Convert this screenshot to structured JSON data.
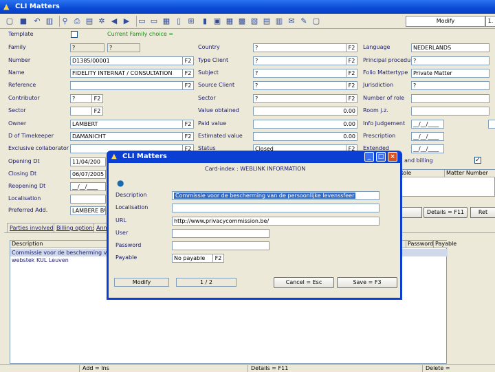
{
  "app": {
    "title": "CLI Matters"
  },
  "toolbar": {
    "mode": "Modify",
    "page": "1."
  },
  "form": {
    "template": {
      "label": "Template",
      "checked": false,
      "note": "Current Family choice ="
    },
    "family": {
      "label": "Family",
      "value1": "?",
      "value2": "?"
    },
    "number": {
      "label": "Number",
      "value": "D1385/00001",
      "btn": "F2"
    },
    "name": {
      "label": "Name",
      "value": "FIDELITY INTERNAT / CONSULTATION",
      "btn": "F2"
    },
    "reference": {
      "label": "Reference",
      "value": "",
      "btn": "F2"
    },
    "contributor": {
      "label": "Contributor",
      "value": "?",
      "btn": "F2"
    },
    "sector_left": {
      "label": "Sector",
      "value": "",
      "btn": "F2"
    },
    "owner": {
      "label": "Owner",
      "value": "LAMBERT",
      "btn": "F2"
    },
    "timekeeper": {
      "label": "D of Timekeeper",
      "value": "DAMANICHT",
      "btn": "F2"
    },
    "exclusive": {
      "label": "Exclusive collaborator",
      "value": "",
      "btn": "F2"
    },
    "opening": {
      "label": "Opening Dt",
      "value": "11/04/200"
    },
    "closing": {
      "label": "Closing Dt",
      "value": "06/07/2005"
    },
    "reopening": {
      "label": "Reopening Dt",
      "value": "__/__/____"
    },
    "localisation": {
      "label": "Localisation",
      "value": ""
    },
    "preferred": {
      "label": "Preferred Add.",
      "value": "LAMBERE BV"
    },
    "country": {
      "label": "Country",
      "value": "?",
      "btn": "F2"
    },
    "type_client": {
      "label": "Type Client",
      "value": "?",
      "btn": "F2"
    },
    "subject": {
      "label": "Subject",
      "value": "?",
      "btn": "F2"
    },
    "source_client": {
      "label": "Source Client",
      "value": "?",
      "btn": "F2"
    },
    "sector_mid": {
      "label": "Sector",
      "value": "?",
      "btn": "F2"
    },
    "value_obtained": {
      "label": "Value obtained",
      "value": "0.00"
    },
    "paid_value": {
      "label": "Paid value",
      "value": "0.00"
    },
    "estimated_value": {
      "label": "Estimated value",
      "value": "0.00"
    },
    "status": {
      "label": "Status",
      "value": "Closed",
      "btn": "F2"
    },
    "language": {
      "label": "Language",
      "value": "NEDERLANDS"
    },
    "principal": {
      "label": "Principal procedure",
      "value": "?"
    },
    "folio": {
      "label": "Folio Mattertype",
      "value": "Private Matter"
    },
    "jurisdiction": {
      "label": "Jurisdiction",
      "value": "?"
    },
    "number_of_role": {
      "label": "Number of role",
      "value": ""
    },
    "room": {
      "label": "Room j.z.",
      "value": ""
    },
    "info_judgement": {
      "label": "Info Judgement",
      "value": "__/__/____"
    },
    "prescription": {
      "label": "Prescription",
      "value": "__/__/____"
    },
    "extended": {
      "label": "Extended",
      "value": "__/__/____"
    },
    "billing_label": "and billing",
    "billing_checked": "✓",
    "role_header": "Role",
    "matter_number_header": "Matter Number",
    "details_f11": "Details = F11",
    "ret": "Ret"
  },
  "tabs": [
    {
      "label": "Parties involved"
    },
    {
      "label": "Billing options"
    },
    {
      "label": "Ann"
    }
  ],
  "grid": {
    "headers": {
      "description": "Description",
      "password": "Password",
      "payable": "Payable"
    },
    "rows": [
      {
        "description": "Commissie voor de bescherming van de"
      },
      {
        "description": "webstek KUL Leuven"
      }
    ]
  },
  "bottom": {
    "add": "Add = Ins",
    "details": "Details = F11",
    "delete": "Delete ="
  },
  "dialog": {
    "title": "CLI Matters",
    "card_index": "Card-index : WEBLINK INFORMATION",
    "description": {
      "label": "Description",
      "value": "Commissie voor de bescherming van de persoonlijke levenssfeer"
    },
    "localisation": {
      "label": "Localisation",
      "value": ""
    },
    "url": {
      "label": "URL",
      "value": "http://www.privacycommission.be/"
    },
    "user": {
      "label": "User",
      "value": ""
    },
    "password": {
      "label": "Password",
      "value": ""
    },
    "payable": {
      "label": "Payable",
      "value": "No payable",
      "btn": "F2"
    },
    "mode": "Modify",
    "record": "1 / 2",
    "cancel": "Cancel = Esc",
    "save": "Save = F3"
  }
}
